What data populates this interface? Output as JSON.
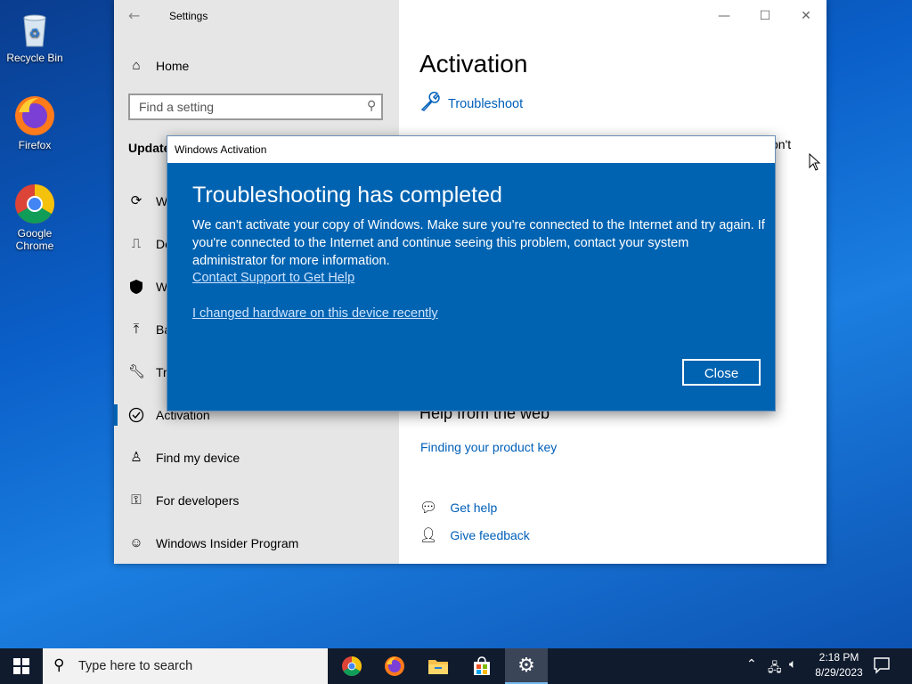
{
  "desktop": {
    "icons": [
      {
        "label": "Recycle Bin",
        "icon": "recycle-bin-icon"
      },
      {
        "label": "Firefox",
        "icon": "firefox-icon"
      },
      {
        "label": "Google Chrome",
        "icon": "chrome-icon"
      }
    ]
  },
  "settings": {
    "title": "Settings",
    "search_placeholder": "Find a setting",
    "home_label": "Home",
    "section_label": "Update",
    "nav": [
      {
        "label": "W",
        "icon": "sync-icon"
      },
      {
        "label": "De",
        "icon": "delivery-icon"
      },
      {
        "label": "W",
        "icon": "shield-icon"
      },
      {
        "label": "Ba",
        "icon": "backup-icon"
      },
      {
        "label": "Tr",
        "icon": "wrench-icon"
      },
      {
        "label": "Activation",
        "icon": "check-circle-icon",
        "selected": true
      },
      {
        "label": "Find my device",
        "icon": "person-pin-icon"
      },
      {
        "label": "For developers",
        "icon": "developer-icon"
      },
      {
        "label": "Windows Insider Program",
        "icon": "insider-icon"
      }
    ],
    "main": {
      "page_title": "Activation",
      "troubleshoot_label": "Troubleshoot",
      "partial_text_1": "on't",
      "partial_text_2": "l",
      "help_heading": "Help from the web",
      "product_key_link": "Finding your product key",
      "get_help": "Get help",
      "give_feedback": "Give feedback"
    }
  },
  "dialog": {
    "title": "Windows Activation",
    "heading": "Troubleshooting has completed",
    "body": "We can't activate your copy of Windows. Make sure you're connected to the Internet and try again. If you're connected to the Internet and continue seeing this problem, contact your system administrator for more information.",
    "link_support": "Contact Support to Get Help",
    "link_hardware": "I changed hardware on this device recently",
    "close_label": "Close"
  },
  "taskbar": {
    "search_placeholder": "Type here to search",
    "time": "2:18 PM",
    "date": "8/29/2023",
    "apps": [
      "chrome-icon",
      "firefox-icon",
      "file-explorer-icon",
      "store-icon",
      "settings-gear-icon"
    ]
  },
  "colors": {
    "accent": "#0063b1",
    "link": "#005fb8",
    "taskbar": "#101b2e"
  }
}
